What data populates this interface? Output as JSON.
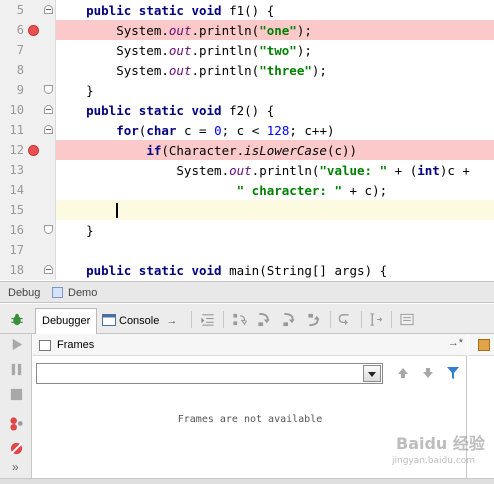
{
  "editor": {
    "lines": [
      {
        "num": "5"
      },
      {
        "num": "6"
      },
      {
        "num": "7"
      },
      {
        "num": "8"
      },
      {
        "num": "9"
      },
      {
        "num": "10"
      },
      {
        "num": "11"
      },
      {
        "num": "12"
      },
      {
        "num": "13"
      },
      {
        "num": "14"
      },
      {
        "num": "15"
      },
      {
        "num": "16"
      },
      {
        "num": "17"
      },
      {
        "num": "18"
      }
    ]
  },
  "debug": {
    "title": "Debug",
    "run_config": "Demo",
    "tabs": {
      "debugger": "Debugger",
      "console": "Console",
      "console_suffix": "→"
    },
    "frames": {
      "title": "Frames",
      "pin": "→*",
      "thread_select_value": "",
      "empty_text": "Frames are not available"
    },
    "more": "»"
  },
  "watermark": {
    "main": "Baidu 经验",
    "sub": "jingyan.baidu.com"
  }
}
